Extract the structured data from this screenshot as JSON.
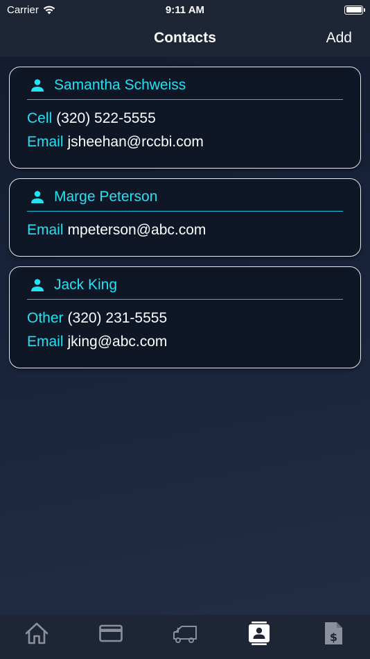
{
  "status_bar": {
    "carrier": "Carrier",
    "time": "9:11 AM"
  },
  "nav": {
    "title": "Contacts",
    "add_label": "Add"
  },
  "contacts": [
    {
      "name": "Samantha Schweiss",
      "fields": [
        {
          "label": "Cell",
          "value": "(320) 522-5555"
        },
        {
          "label": "Email",
          "value": "jsheehan@rccbi.com"
        }
      ]
    },
    {
      "name": "Marge Peterson",
      "fields": [
        {
          "label": "Email",
          "value": "mpeterson@abc.com"
        }
      ]
    },
    {
      "name": "Jack King",
      "fields": [
        {
          "label": "Other",
          "value": "(320) 231-5555"
        },
        {
          "label": "Email",
          "value": "jking@abc.com"
        }
      ]
    }
  ],
  "tabs": [
    {
      "icon": "home-icon",
      "active": false
    },
    {
      "icon": "credit-card-icon",
      "active": false
    },
    {
      "icon": "truck-icon",
      "active": false
    },
    {
      "icon": "contact-card-icon",
      "active": true
    },
    {
      "icon": "invoice-icon",
      "active": false
    }
  ],
  "colors": {
    "accent": "#22e3f2",
    "active_tab": "#ffffff",
    "inactive_tab": "#8a909c",
    "card_bg": "#0f1626",
    "bar_bg": "#1e2535"
  }
}
